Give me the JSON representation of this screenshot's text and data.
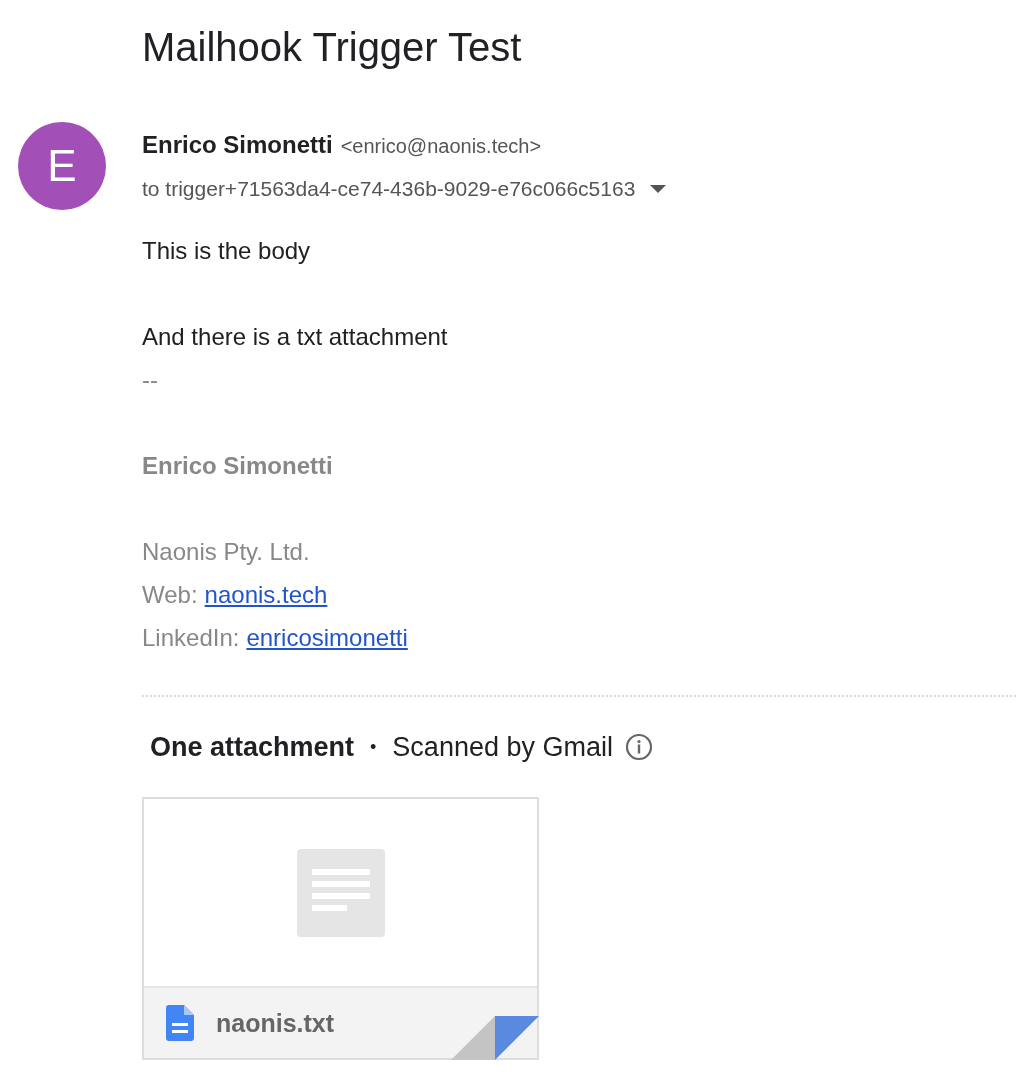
{
  "subject": "Mailhook Trigger Test",
  "sender": {
    "initial": "E",
    "color": "#a24fb8",
    "name": "Enrico Simonetti",
    "email": "<enrico@naonis.tech>"
  },
  "recipient": "to trigger+71563da4-ce74-436b-9029-e76c066c5163",
  "body": [
    "This is the body",
    "And there is a txt attachment"
  ],
  "signature": {
    "separator": "--",
    "name": "Enrico Simonetti",
    "company": "Naonis Pty. Ltd.",
    "links": [
      {
        "label": "Web:",
        "link": "naonis.tech"
      },
      {
        "label": "LinkedIn:",
        "link": "enricosimonetti"
      }
    ]
  },
  "attachments": {
    "title": "One attachment",
    "separator": "•",
    "scan_note": "Scanned by Gmail",
    "files": [
      {
        "name": "naonis.txt"
      }
    ]
  }
}
